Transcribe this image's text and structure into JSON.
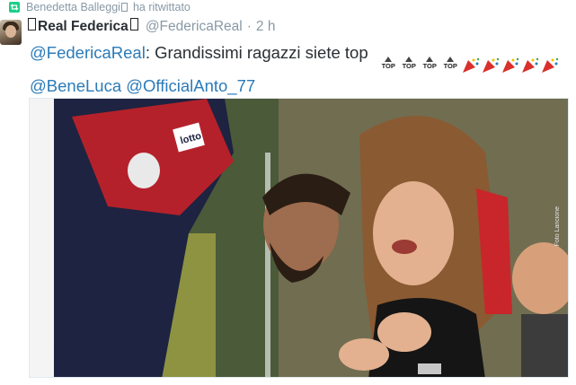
{
  "retweet": {
    "user": "Benedetta Balleggi",
    "label": "ha ritwittato"
  },
  "tweet": {
    "display_name": "Real Federica",
    "handle": "@FedericaReal",
    "separator": "·",
    "time": "2 h",
    "text_mention": "@FedericaReal",
    "text_body": ": Grandissimi ragazzi siete top",
    "mention_2": "@BeneLuca",
    "mention_3": "@OfficialAnto_77",
    "emoji_top_label": "TOP"
  },
  "photo": {
    "watermark": "Foto Lancione",
    "jersey_sponsor": "lotto"
  },
  "colors": {
    "link": "#2b7bb9",
    "muted": "#8899a6",
    "text": "#292f33",
    "retweet_green": "#19cf86"
  }
}
